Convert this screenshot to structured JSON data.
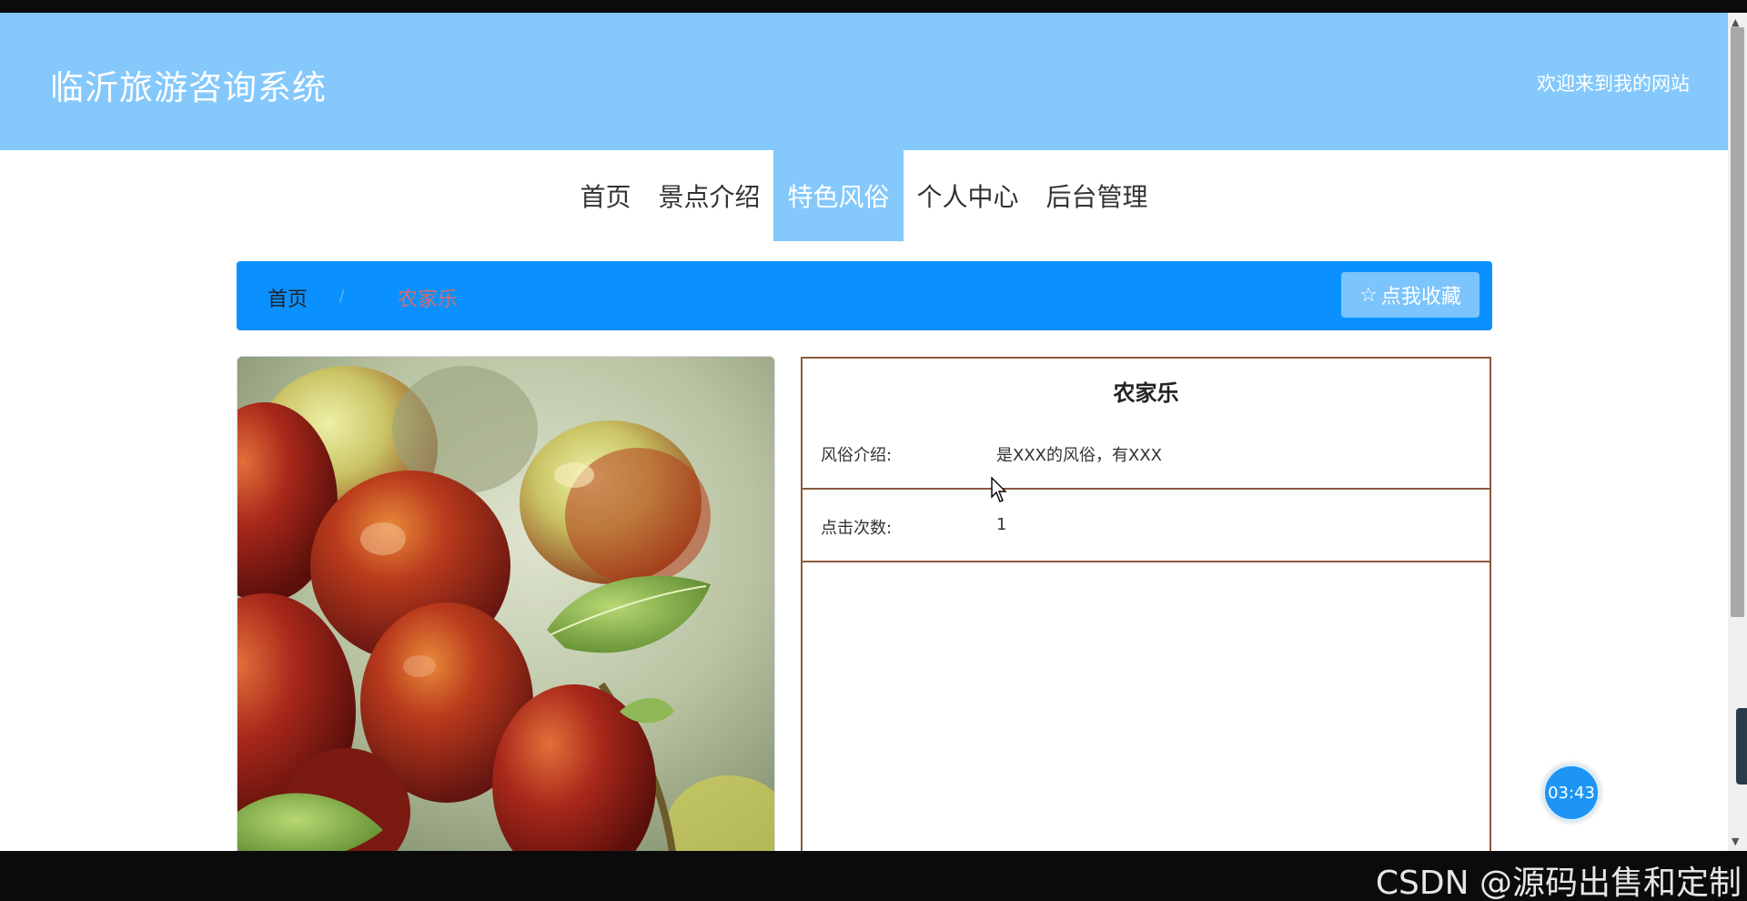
{
  "header": {
    "site_title": "临沂旅游咨询系统",
    "welcome": "欢迎来到我的网站"
  },
  "nav": {
    "items": [
      {
        "label": "首页",
        "active": false
      },
      {
        "label": "景点介绍",
        "active": false
      },
      {
        "label": "特色风俗",
        "active": true
      },
      {
        "label": "个人中心",
        "active": false
      },
      {
        "label": "后台管理",
        "active": false
      }
    ]
  },
  "breadcrumb": {
    "home": "首页",
    "separator": "/",
    "current": "农家乐"
  },
  "favorite_button": {
    "icon": "star-outline-icon",
    "label": "点我收藏"
  },
  "detail": {
    "title": "农家乐",
    "intro_label": "风俗介绍:",
    "intro_value": "是XXX的风俗，有XXX",
    "clicks_label": "点击次数:",
    "clicks_value": "1"
  },
  "timer": {
    "value": "03:43"
  },
  "watermark": "CSDN @源码出售和定制",
  "colors": {
    "header_bg": "#84c8fc",
    "breadcrumb_bg": "#0a91ff",
    "detail_border": "#8b5a3c",
    "timer_bg": "#1e95f5"
  }
}
